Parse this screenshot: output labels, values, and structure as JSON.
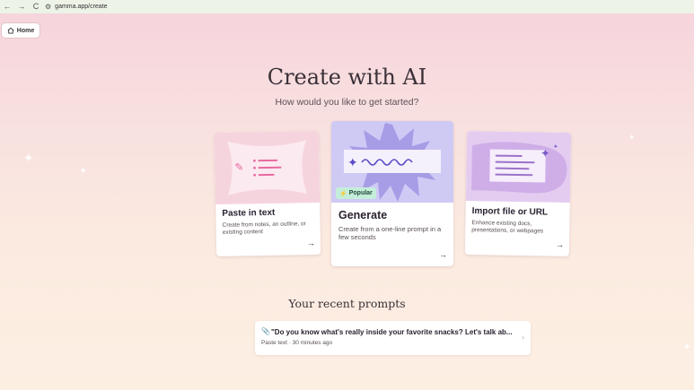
{
  "browser": {
    "back": "←",
    "forward": "→",
    "reload": "C",
    "url": "gamma.app/create"
  },
  "home": {
    "label": "Home"
  },
  "header": {
    "title": "Create with AI",
    "subtitle": "How would you like to get started?"
  },
  "cards": {
    "paste": {
      "title": "Paste in text",
      "desc": "Create from notes, an outline, or existing content",
      "arrow": "→"
    },
    "generate": {
      "badge": "Popular",
      "title": "Generate",
      "desc": "Create from a one-line prompt in a few seconds",
      "arrow": "→"
    },
    "import": {
      "title": "Import file or URL",
      "desc": "Enhance existing docs, presentations, or webpages",
      "arrow": "→"
    }
  },
  "recent": {
    "title": "Your recent prompts",
    "items": [
      {
        "text": "\"Do you know what's really inside your favorite snacks? Let's talk ab...",
        "meta": "Paste text · 30 minutes ago"
      }
    ]
  },
  "colors": {
    "paste_art": "#f6d4de",
    "generate_art": "#cfcaf4",
    "import_art": "#e4ccf0",
    "popular_badge": "#c4eed9"
  }
}
